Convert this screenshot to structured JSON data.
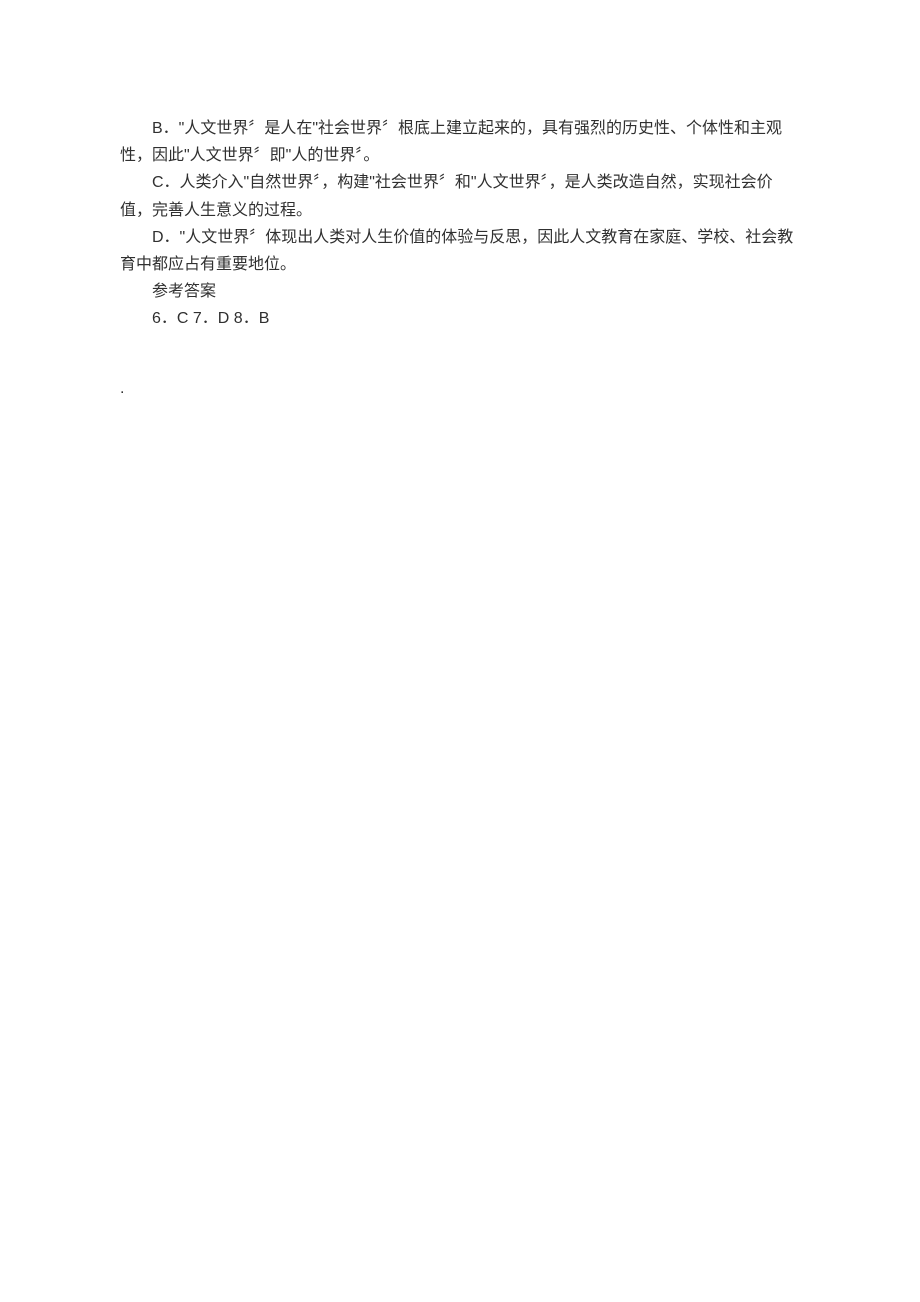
{
  "paragraphs": {
    "optionB": "B．\"人文世界〞是人在\"社会世界〞根底上建立起来的，具有强烈的历史性、个体性和主观性，因此\"人文世界〞即\"人的世界〞。",
    "optionC": "C．人类介入\"自然世界〞，构建\"社会世界〞和\"人文世界〞，是人类改造自然，实现社会价值，完善人生意义的过程。",
    "optionD": "D．\"人文世界〞体现出人类对人生价值的体验与反思，因此人文教育在家庭、学校、社会教育中都应占有重要地位。",
    "referenceLabel": "参考答案",
    "answers": "6．C 7．D 8．B",
    "dot": "."
  }
}
